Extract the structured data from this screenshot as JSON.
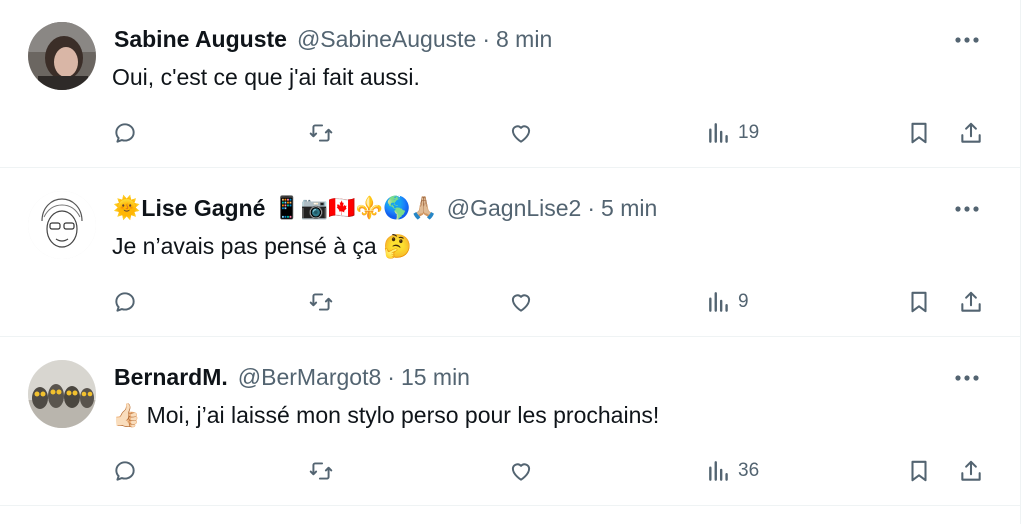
{
  "colors": {
    "text": "#0f1419",
    "secondary": "#536471",
    "divider": "#eff3f4"
  },
  "tweets": [
    {
      "name": "Sabine Auguste",
      "name_prefix": "",
      "name_suffix": "",
      "handle": "@SabineAuguste",
      "separator": "·",
      "time": "8 min",
      "text": "Oui, c'est ce que j'ai fait aussi.",
      "text_prefix": "",
      "text_suffix": "",
      "views": "19",
      "avatar": "photo-woman-dark-hair"
    },
    {
      "name": "Lise Gagné",
      "name_prefix": "🌞",
      "name_suffix": "📱📷🇨🇦⚜️🌎🙏🏼",
      "handle": "@GagnLise2",
      "separator": "·",
      "time": "5 min",
      "text": "Je n’avais pas pensé à ça",
      "text_prefix": "",
      "text_suffix": "🤔",
      "views": "9",
      "avatar": "sketch-portrait"
    },
    {
      "name": "BernardM.",
      "name_prefix": "",
      "name_suffix": "",
      "handle": "@BerMargot8",
      "separator": "·",
      "time": "15 min",
      "text": "Moi, j’ai laissé mon stylo perso pour les prochains!",
      "text_prefix": "👍🏻",
      "text_suffix": "",
      "views": "36",
      "avatar": "owls-photo"
    }
  ]
}
